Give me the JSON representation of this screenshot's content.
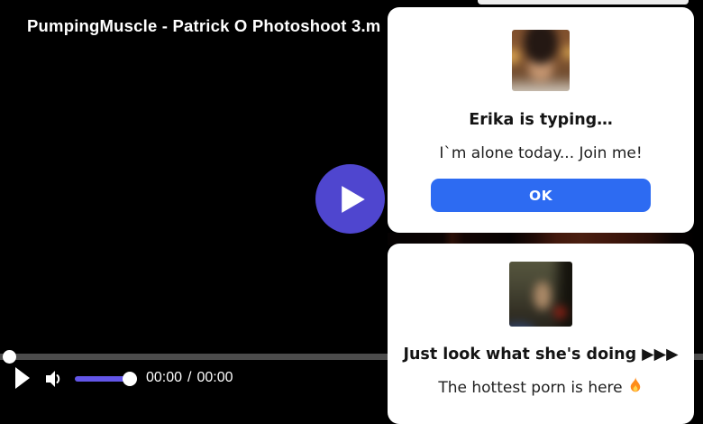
{
  "player": {
    "title": "PumpingMuscle - Patrick O Photoshoot 3.m",
    "current_time": "00:00",
    "time_separator": "/",
    "duration": "00:00",
    "icons": {
      "big_play": "play-icon",
      "play": "play-icon",
      "volume": "speaker-icon"
    },
    "colors": {
      "background": "#000000",
      "play_overlay": "#4f46cf",
      "volume_fill": "#6356e8",
      "seek_track": "#4c4c4c"
    }
  },
  "overlays": {
    "popups": [
      {
        "thumbnail": "blurred-photo-thumbnail",
        "title": "Erika is typing…",
        "body": "I`m alone today... Join me!",
        "button": "OK",
        "button_color": "#2d6bf2"
      },
      {
        "thumbnail": "blurred-photo-thumbnail",
        "title": "Just look what she's doing ▶▶▶",
        "body": "The hottest porn is here",
        "body_icon": "fire-icon"
      }
    ]
  }
}
